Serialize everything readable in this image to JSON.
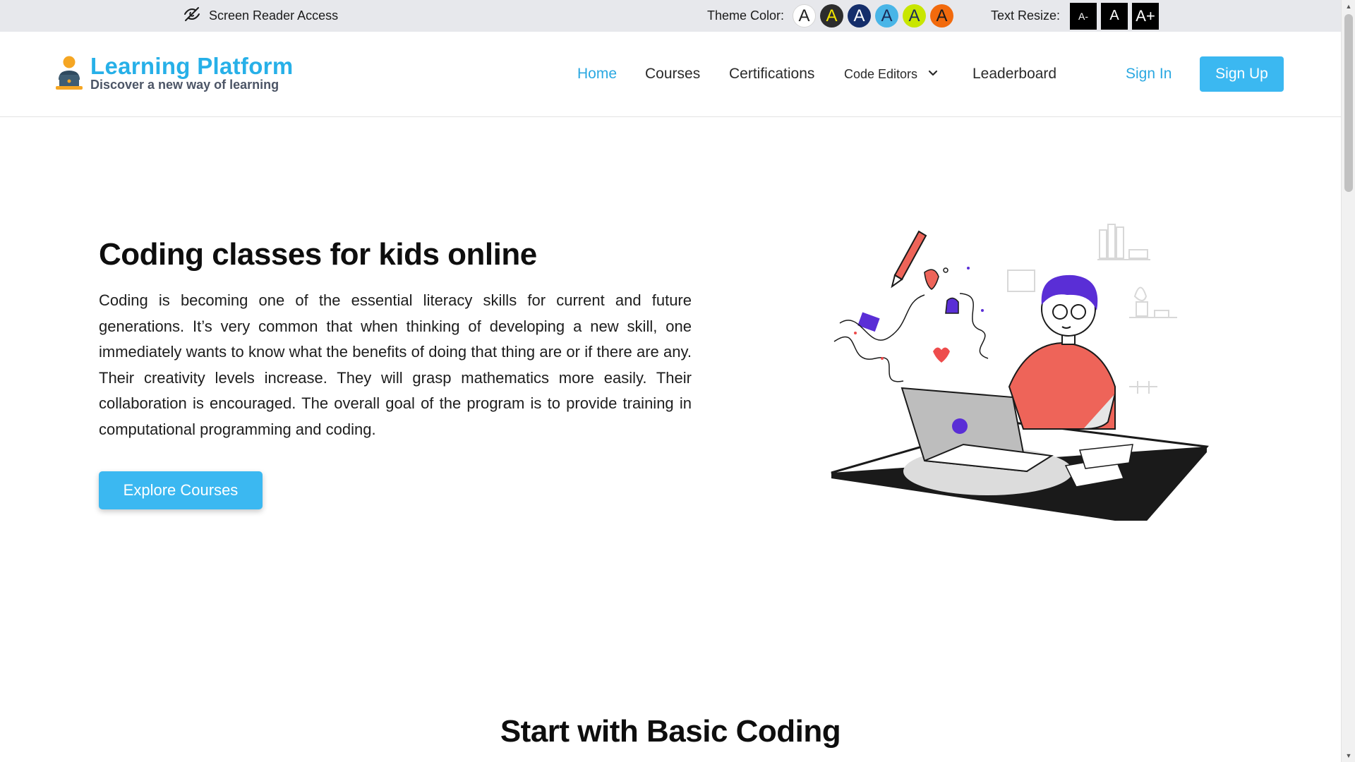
{
  "topbar": {
    "screen_reader_label": "Screen Reader Access",
    "theme_label": "Theme Color:",
    "theme_swatches": [
      {
        "letter": "A",
        "bg": "#ffffff",
        "fg": "#222222"
      },
      {
        "letter": "A",
        "bg": "#2d2d2d",
        "fg": "#f3e500"
      },
      {
        "letter": "A",
        "bg": "#152e6b",
        "fg": "#ffffff"
      },
      {
        "letter": "A",
        "bg": "#49b5e7",
        "fg": "#1a2a57"
      },
      {
        "letter": "A",
        "bg": "#c8e600",
        "fg": "#1a2a57"
      },
      {
        "letter": "A",
        "bg": "#f26a0d",
        "fg": "#1a1a1a"
      }
    ],
    "resize_label": "Text Resize:",
    "resize_buttons": [
      "A-",
      "A",
      "A+"
    ]
  },
  "header": {
    "logo_title": "Learning Platform",
    "logo_subtitle": "Discover a new way of learning",
    "nav": {
      "home": "Home",
      "courses": "Courses",
      "certifications": "Certifications",
      "code_editors": "Code Editors",
      "leaderboard": "Leaderboard"
    },
    "sign_in": "Sign In",
    "sign_up": "Sign Up"
  },
  "hero": {
    "title": "Coding classes for kids online",
    "text": "Coding is becoming one of the essential literacy skills for current and future generations. It’s very common that when thinking of developing a new skill, one immediately wants to know what the benefits of doing that thing are or if there are any. Their creativity levels increase. They will grasp mathematics more easily. Their collaboration is encouraged. The overall goal of the program is to provide training in computational programming and coding.",
    "cta": "Explore Courses"
  },
  "section": {
    "title": "Start with Basic Coding"
  },
  "colors": {
    "accent": "#3bb8f1",
    "topbar_bg": "#e7e8ec",
    "logo_blue": "#27b0e8"
  },
  "icons": {
    "screen_reader": "eye-slash-icon",
    "dropdown": "chevron-down-icon"
  }
}
